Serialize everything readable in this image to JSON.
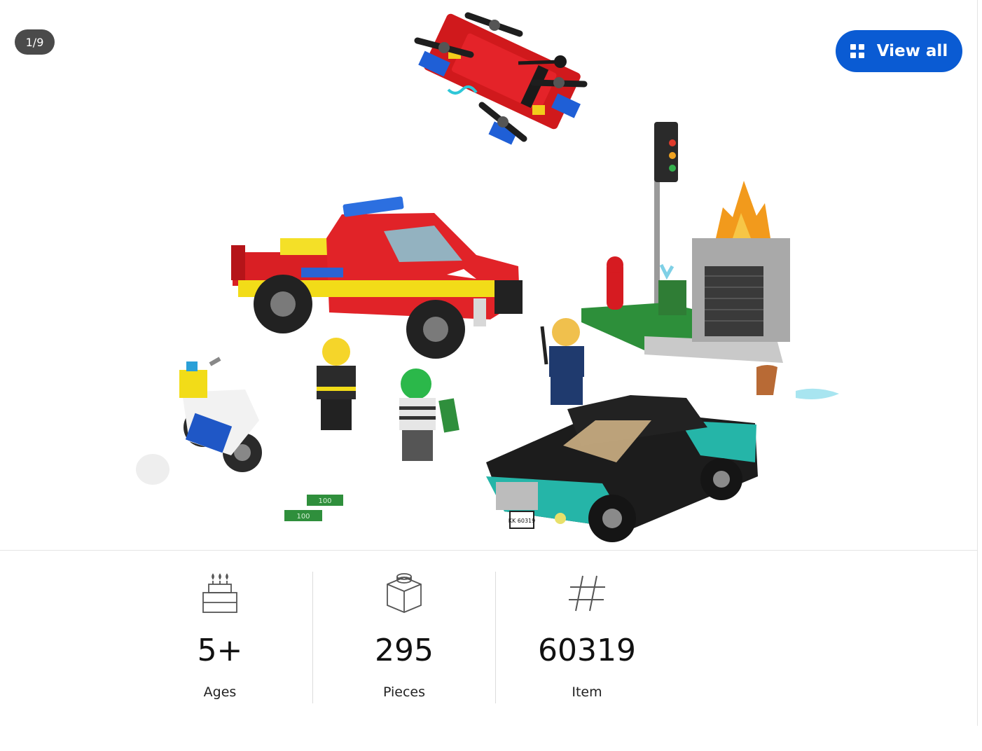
{
  "gallery": {
    "counter": "1/9",
    "view_all_label": "View all",
    "view_all_icon": "grid-icon",
    "accent_color": "#0a5bd3",
    "image_alt": "LEGO City fire rescue and police chase set with fire truck, drone, police motorcycle, minifigures, traffic light, burning building and black sports car",
    "license_plate": "KK 60319",
    "cash_label": "100"
  },
  "facts": [
    {
      "icon": "cake-icon",
      "value": "5+",
      "label": "Ages"
    },
    {
      "icon": "brick-icon",
      "value": "295",
      "label": "Pieces"
    },
    {
      "icon": "hash-icon",
      "value": "60319",
      "label": "Item"
    }
  ]
}
